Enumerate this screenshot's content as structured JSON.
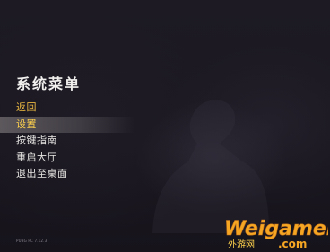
{
  "menu": {
    "title": "系统菜单",
    "items": [
      {
        "label": "返回",
        "state": "active"
      },
      {
        "label": "设置",
        "state": "hover"
      },
      {
        "label": "按键指南",
        "state": "normal"
      },
      {
        "label": "重启大厅",
        "state": "normal"
      },
      {
        "label": "退出至桌面",
        "state": "normal"
      }
    ]
  },
  "footer": {
    "version": "PUBG PC 7.12.3"
  },
  "watermark": {
    "text": "Weigamer",
    "sub": "外游网",
    "domain": ".com",
    "colors": {
      "primary": "#f5a623",
      "secondary": "#ffd34d"
    }
  },
  "colors": {
    "active": "#e8b641",
    "hover": "#ffd24d",
    "text": "#e8e6e3",
    "background": "#1b1820"
  }
}
